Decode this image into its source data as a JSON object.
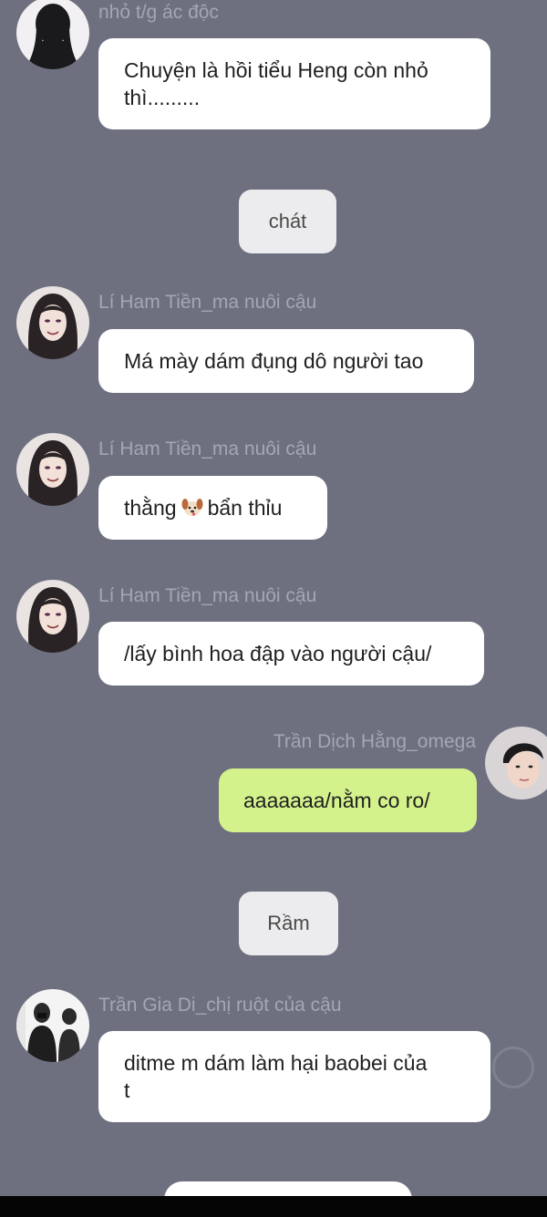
{
  "colors": {
    "background": "#6e7080",
    "bubble_incoming": "#ffffff",
    "bubble_outgoing": "#d4f28c",
    "system_bubble": "#ececee",
    "name_text": "#a4a6b2"
  },
  "messages": [
    {
      "sender": "nhỏ t/g ác độc",
      "avatar": "dark-silhouette-avatar",
      "lines": [
        "Chuyện là hồi tiểu Heng còn nhỏ",
        "thì........."
      ]
    },
    {
      "system": "chát"
    },
    {
      "sender": "Lí Ham Tiền_ma nuôi cậu",
      "avatar": "long-hair-girl-avatar",
      "lines": [
        "Má mày dám đụng dô người tao"
      ]
    },
    {
      "sender": "Lí Ham Tiền_ma nuôi cậu",
      "avatar": "long-hair-girl-avatar",
      "text_before": "thằng",
      "emoji": "dog-emoji",
      "text_after": "bẩn thỉu"
    },
    {
      "sender": "Lí Ham Tiền_ma nuôi cậu",
      "avatar": "long-hair-girl-avatar",
      "lines": [
        "/lấy bình hoa đập vào người cậu/"
      ]
    },
    {
      "sender": "Trần Dịch Hằng_omega",
      "avatar": "boy-avatar",
      "lines": [
        "aaaaaaa/nằm co ro/"
      ]
    },
    {
      "system": "Rầm"
    },
    {
      "sender": "Trần Gia Di_chị ruột của cậu",
      "avatar": "two-people-photo-avatar",
      "lines": [
        "ditme m dám làm hại baobei của",
        "t"
      ]
    }
  ]
}
